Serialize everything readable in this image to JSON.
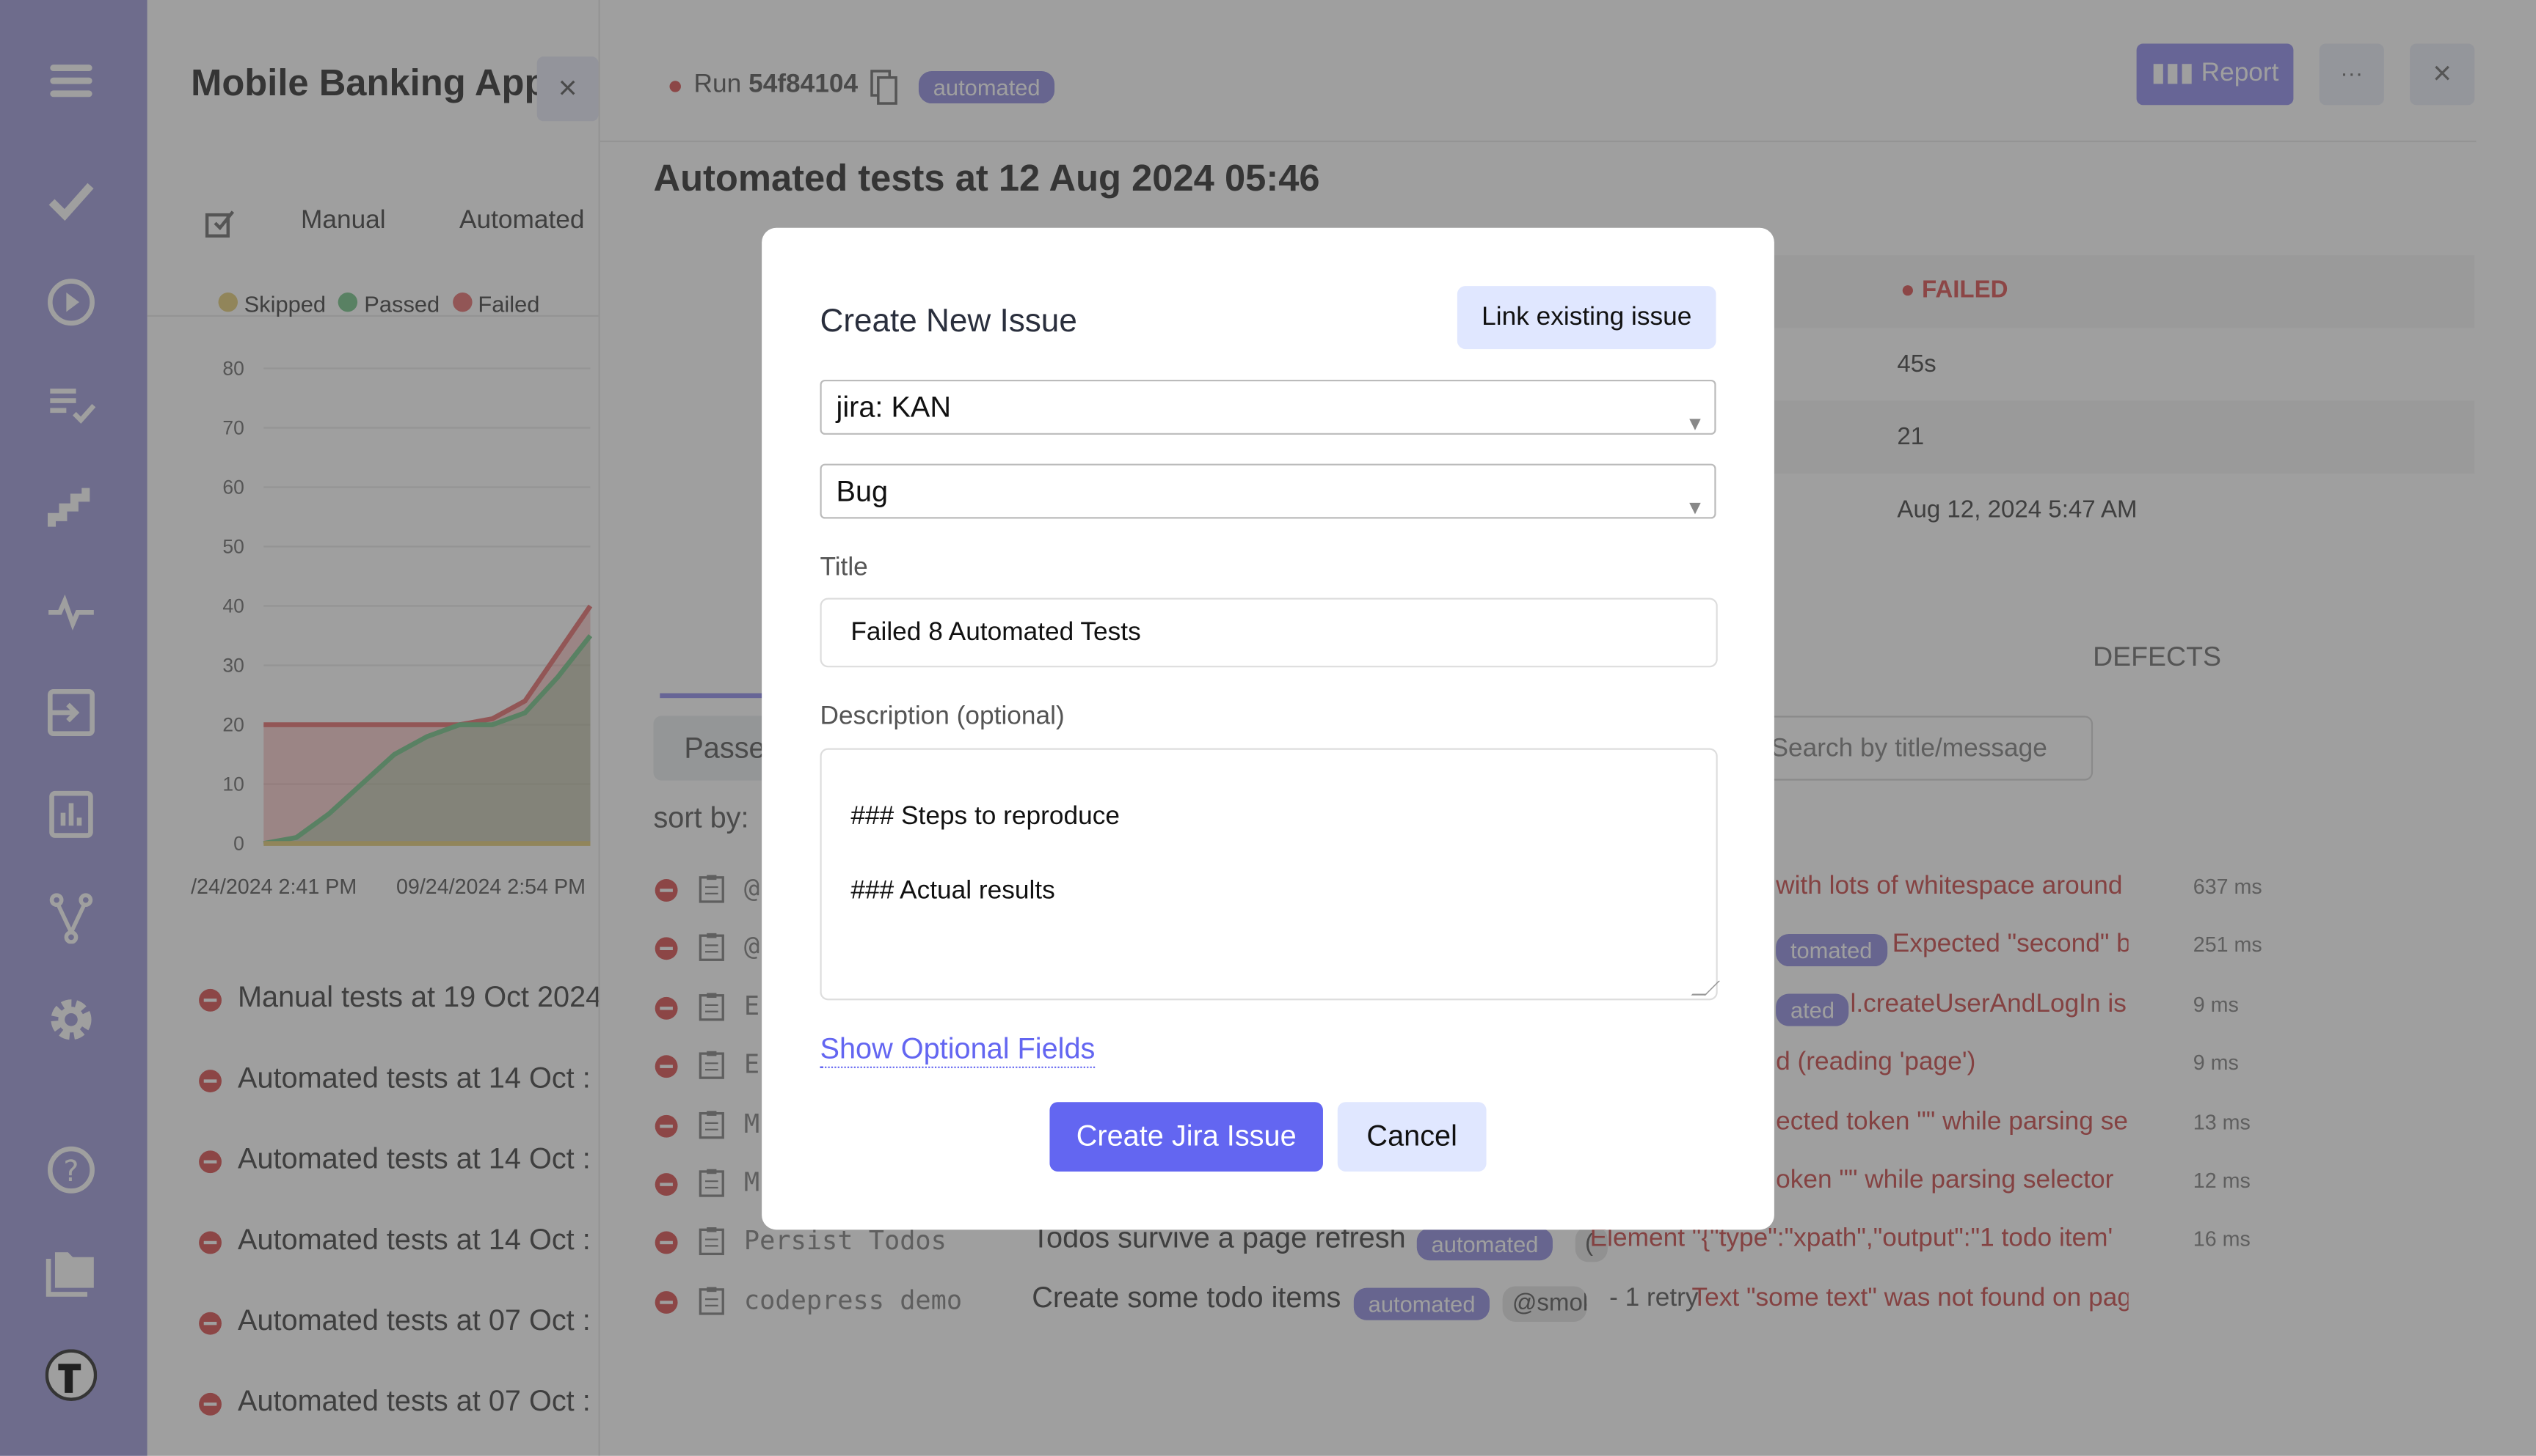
{
  "sidebar": {
    "items": [
      {
        "icon": "hamburger-menu-icon"
      },
      {
        "icon": "checkmark-icon"
      },
      {
        "icon": "play-circle-icon"
      },
      {
        "icon": "checklist-icon"
      },
      {
        "icon": "stairs-icon"
      },
      {
        "icon": "pulse-icon"
      },
      {
        "icon": "import-icon"
      },
      {
        "icon": "bar-chart-icon"
      },
      {
        "icon": "branch-icon"
      },
      {
        "icon": "gear-icon"
      },
      {
        "icon": "help-icon"
      },
      {
        "icon": "folder-icon"
      },
      {
        "icon": "logo-icon"
      }
    ]
  },
  "left_panel": {
    "project_title": "Mobile Banking App",
    "close_label": "×",
    "tabs": [
      "Manual",
      "Automated"
    ],
    "legend": [
      {
        "label": "Skipped",
        "color": "#e8d590"
      },
      {
        "label": "Passed",
        "color": "#8fcf9f"
      },
      {
        "label": "Failed",
        "color": "#eb8a8a"
      }
    ],
    "runs": [
      "Manual tests at 19 Oct 2024",
      "Automated tests at 14 Oct :",
      "Automated tests at 14 Oct :",
      "Automated tests at 14 Oct :",
      "Automated tests at 07 Oct :",
      "Automated tests at 07 Oct :"
    ]
  },
  "chart_data": {
    "type": "area",
    "y_ticks": [
      "0",
      "10",
      "20",
      "30",
      "40",
      "50",
      "60",
      "70",
      "80"
    ],
    "ylim": [
      0,
      80
    ],
    "x_tick_labels": [
      "/24/2024 2:41 PM",
      "09/24/2024 2:54 PM"
    ],
    "grid": true,
    "series": [
      {
        "name": "Skipped",
        "color": "#e8d590",
        "values": [
          0,
          0,
          0,
          0,
          0,
          0,
          0,
          0,
          0,
          0,
          0
        ]
      },
      {
        "name": "Passed",
        "color": "#8fcf9f",
        "values": [
          0,
          1,
          5,
          10,
          15,
          18,
          20,
          20,
          22,
          28,
          35
        ]
      },
      {
        "name": "Failed",
        "color": "#eb8a8a",
        "values": [
          20,
          20,
          20,
          20,
          20,
          20,
          20,
          21,
          24,
          32,
          40
        ]
      }
    ]
  },
  "header": {
    "run_label": "Run",
    "run_id": "54f84104",
    "run_badge": "automated",
    "report_label": "Report",
    "more_label": "···",
    "close_label": "×",
    "title": "Automated tests at 12 Aug 2024 05:46"
  },
  "details": {
    "status": "FAILED",
    "duration": "45s",
    "count": "21",
    "finished": "Aug 12, 2024 5:47 AM",
    "defects_tab": "DEFECTS"
  },
  "filters": {
    "passed_btn": "Passe",
    "search_placeholder": "Search by title/message",
    "sort_label": "sort by:"
  },
  "tests": [
    {
      "suite": "@",
      "title": "",
      "badge": "",
      "message": "with lots of whitespace around",
      "duration": "637 ms"
    },
    {
      "suite": "@",
      "title": "",
      "badge": "tomated",
      "message": "Expected \"second\" b",
      "duration": "251 ms"
    },
    {
      "suite": "E",
      "title": "",
      "badge": "ated",
      "message": "l.createUserAndLogIn is",
      "duration": "9 ms"
    },
    {
      "suite": "E",
      "title": "",
      "badge": "",
      "message": "d (reading 'page')",
      "duration": "9 ms"
    },
    {
      "suite": "M",
      "title": "",
      "badge": "",
      "message": "ected token \"\" while parsing se",
      "duration": "13 ms"
    },
    {
      "suite": "M",
      "title": "",
      "badge": "",
      "message": "oken \"\" while parsing selector",
      "duration": "12 ms"
    },
    {
      "suite": "Persist Todos",
      "title": "Todos survive a page refresh",
      "badge": "automated",
      "tag": "(",
      "message": "Element \"{\"type\":\"xpath\",\"output\":\"1 todo item'",
      "duration": "16 ms"
    },
    {
      "suite": "codepress demo",
      "title": "Create some todo items",
      "badge": "automated",
      "tag": "@smok",
      "retry": "- 1 retry",
      "message": "Text \"some text\" was not found on pag",
      "duration": ""
    }
  ],
  "modal": {
    "title": "Create New Issue",
    "link_existing": "Link existing issue",
    "project_select": "jira: KAN",
    "type_select": "Bug",
    "title_label": "Title",
    "title_value": "Failed 8 Automated Tests",
    "description_label": "Description (optional)",
    "description_lines": [
      "### Steps to reproduce",
      "### Actual results"
    ],
    "show_optional": "Show Optional Fields",
    "create_button": "Create Jira Issue",
    "cancel_button": "Cancel",
    "accent": "#6366f1"
  }
}
